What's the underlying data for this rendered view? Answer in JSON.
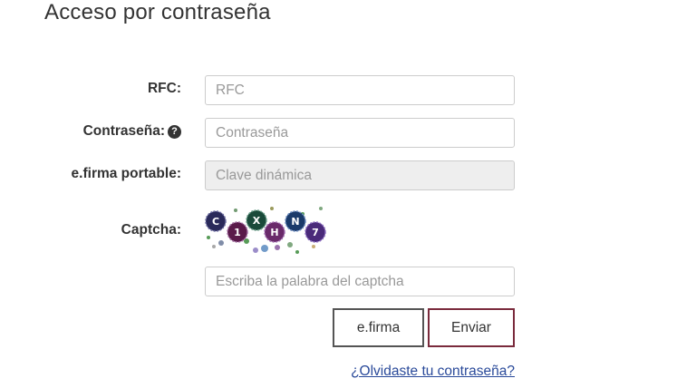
{
  "title": "Acceso por contraseña",
  "form": {
    "rfc": {
      "label": "RFC:",
      "placeholder": "RFC"
    },
    "password": {
      "label": "Contraseña:",
      "placeholder": "Contraseña",
      "help_icon": "question-circle-icon"
    },
    "efirma_portable": {
      "label": "e.firma portable:",
      "placeholder": "Clave dinámica"
    },
    "captcha": {
      "label": "Captcha:",
      "text": "C1XHN7",
      "placeholder": "Escriba la palabra del captcha"
    }
  },
  "buttons": {
    "efirma": "e.firma",
    "enviar": "Enviar"
  },
  "forgot_link": "¿Olvidaste tu contraseña?",
  "colors": {
    "accent": "#7a2a3c",
    "link": "#2a4a9a",
    "disabled_bg": "#eeeeee"
  }
}
